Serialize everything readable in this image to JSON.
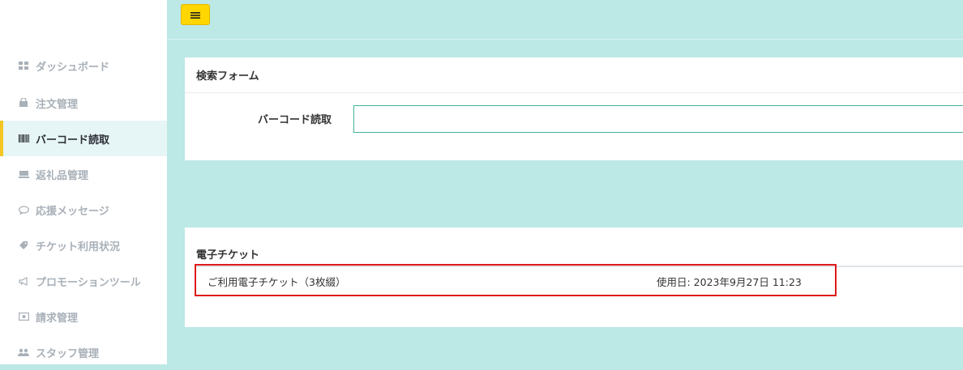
{
  "sidebar": {
    "items": [
      {
        "label": "ダッシュボード",
        "icon": "dashboard-icon",
        "active": false
      },
      {
        "label": "注文管理",
        "icon": "bag-icon",
        "active": false
      },
      {
        "label": "バーコード読取",
        "icon": "barcode-icon",
        "active": true
      },
      {
        "label": "返礼品管理",
        "icon": "gift-tray-icon",
        "active": false
      },
      {
        "label": "応援メッセージ",
        "icon": "speech-bubble-icon",
        "active": false
      },
      {
        "label": "チケット利用状況",
        "icon": "ticket-tag-icon",
        "active": false
      },
      {
        "label": "プロモーションツール",
        "icon": "megaphone-icon",
        "active": false
      },
      {
        "label": "請求管理",
        "icon": "money-icon",
        "active": false
      },
      {
        "label": "スタッフ管理",
        "icon": "users-icon",
        "active": false
      }
    ]
  },
  "header": {
    "menu_icon": "hamburger-icon"
  },
  "search_form": {
    "title": "検索フォーム",
    "barcode_label": "バーコード読取",
    "barcode_value": "",
    "barcode_placeholder": ""
  },
  "ticket": {
    "title": "電子チケット",
    "row_name": "ご利用電子チケット（3枚綴）",
    "row_date": "使用日: 2023年9月27日 11:23"
  },
  "colors": {
    "background": "#bce8e6",
    "accent_yellow": "#ffd600",
    "input_border": "#40b49a",
    "highlight_red": "#e01919",
    "active_bg": "#e6f5f5"
  }
}
